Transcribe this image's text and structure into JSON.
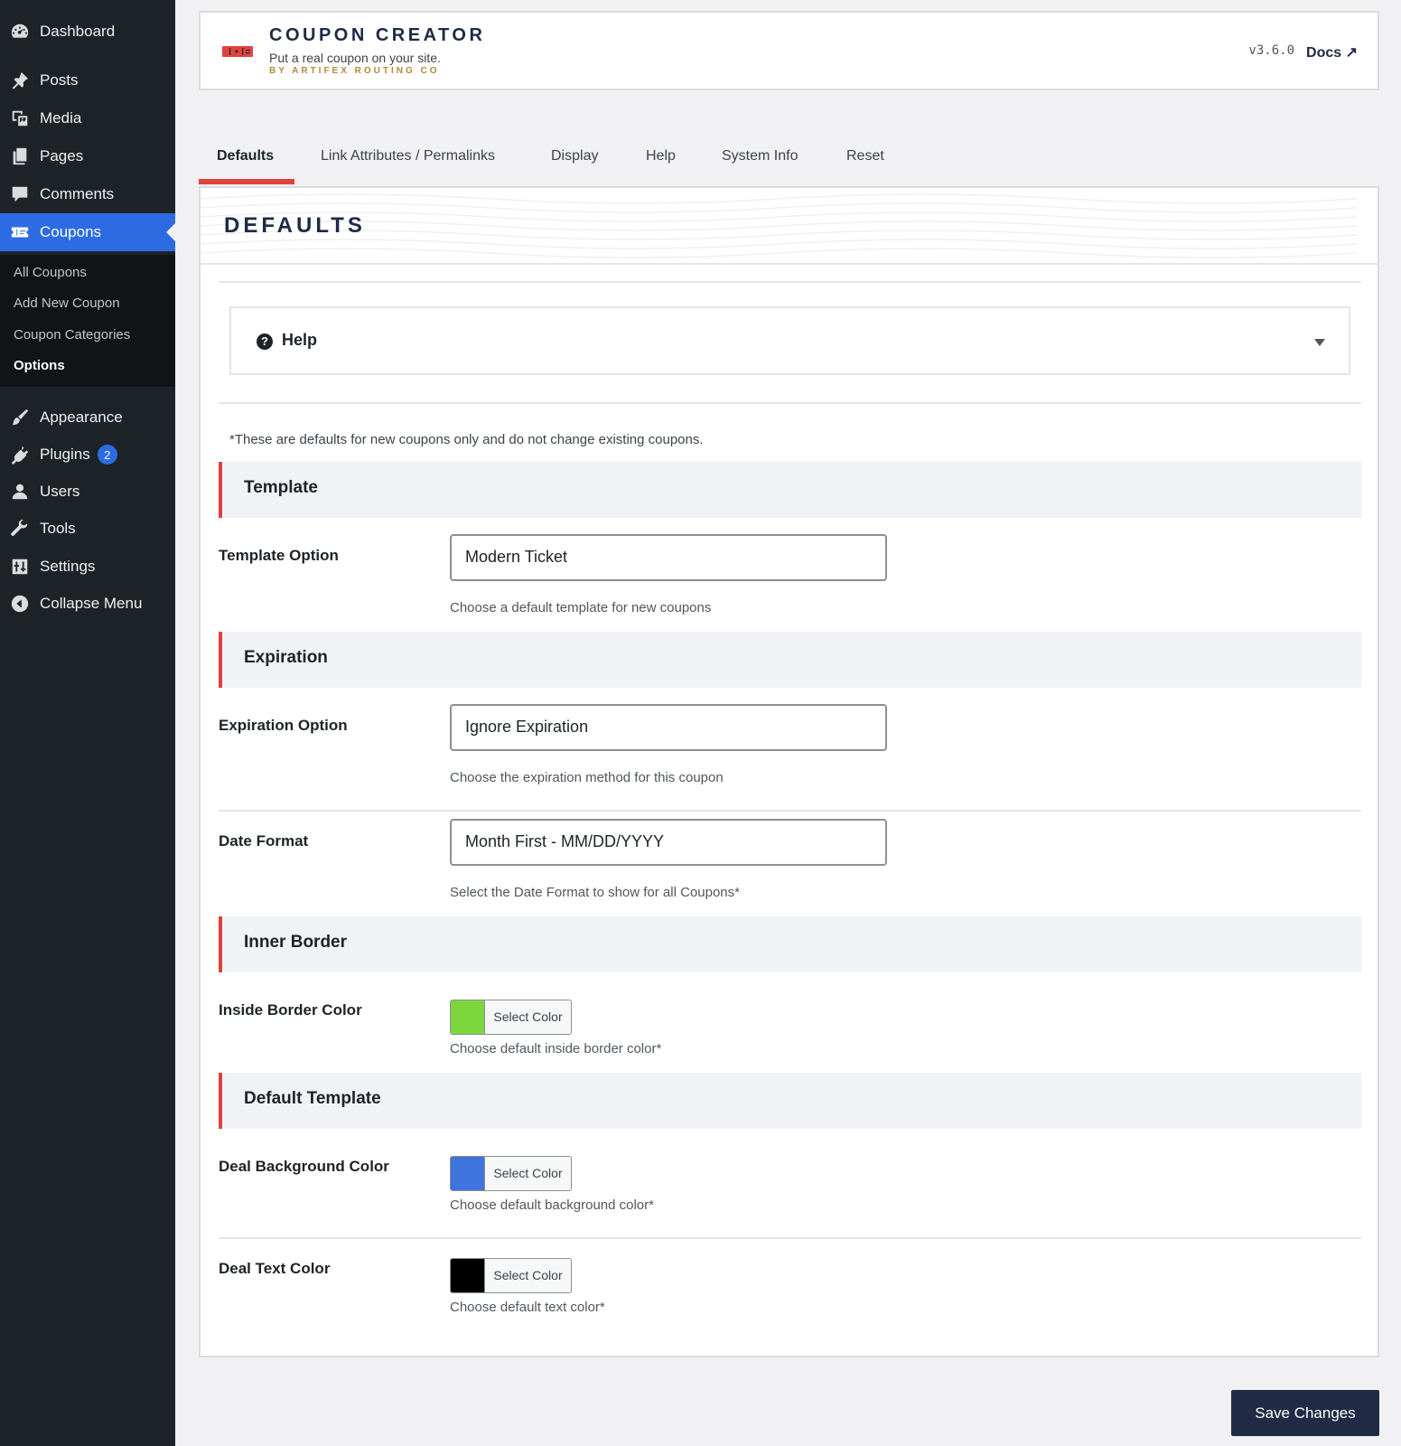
{
  "sidebar": {
    "items": [
      {
        "label": "Dashboard",
        "icon": "dashboard-icon"
      },
      {
        "label": "Posts",
        "icon": "pin-icon"
      },
      {
        "label": "Media",
        "icon": "media-icon"
      },
      {
        "label": "Pages",
        "icon": "pages-icon"
      },
      {
        "label": "Comments",
        "icon": "comment-icon"
      },
      {
        "label": "Coupons",
        "icon": "ticket-icon"
      },
      {
        "label": "Appearance",
        "icon": "brush-icon"
      },
      {
        "label": "Plugins",
        "icon": "plug-icon",
        "badge": "2"
      },
      {
        "label": "Users",
        "icon": "user-icon"
      },
      {
        "label": "Tools",
        "icon": "wrench-icon"
      },
      {
        "label": "Settings",
        "icon": "sliders-icon"
      },
      {
        "label": "Collapse Menu",
        "icon": "collapse-icon"
      }
    ],
    "submenu": [
      "All Coupons",
      "Add New Coupon",
      "Coupon Categories",
      "Options"
    ]
  },
  "header": {
    "title": "COUPON CREATOR",
    "tagline": "Put a real coupon on your site.",
    "byline": "BY ARTIFEX ROUTING CO",
    "version": "v3.6.0",
    "docs_label": "Docs ↗"
  },
  "tabs": [
    "Defaults",
    "Link Attributes / Permalinks",
    "Display",
    "Help",
    "System Info",
    "Reset"
  ],
  "main": {
    "title": "DEFAULTS",
    "help_label": "Help",
    "help_icon": "?",
    "note": "*These are defaults for new coupons only and do not change existing coupons.",
    "sections": {
      "template": {
        "heading": "Template",
        "label": "Template Option",
        "value": "Modern Ticket",
        "desc": "Choose a default template for new coupons"
      },
      "expiration": {
        "heading": "Expiration",
        "option_label": "Expiration Option",
        "option_value": "Ignore Expiration",
        "option_desc": "Choose the expiration method for this coupon",
        "date_label": "Date Format",
        "date_value": "Month First - MM/DD/YYYY",
        "date_desc": "Select the Date Format to show for all Coupons*"
      },
      "inner_border": {
        "heading": "Inner Border",
        "label": "Inside Border Color",
        "color": "#7ed63f",
        "button_label": "Select Color",
        "desc": "Choose default inside border color*"
      },
      "default_template": {
        "heading": "Default Template",
        "bg_label": "Deal Background Color",
        "bg_color": "#3f73dd",
        "bg_button_label": "Select Color",
        "bg_desc": "Choose default background color*",
        "text_label": "Deal Text Color",
        "text_color": "#000000",
        "text_button_label": "Select Color",
        "text_desc": "Choose default text color*"
      }
    }
  },
  "footer": {
    "save_label": "Save Changes"
  },
  "colors": {
    "accent": "#2d6be3",
    "brand_red": "#e0423e",
    "navy": "#202a44",
    "gold": "#b28a3a"
  }
}
